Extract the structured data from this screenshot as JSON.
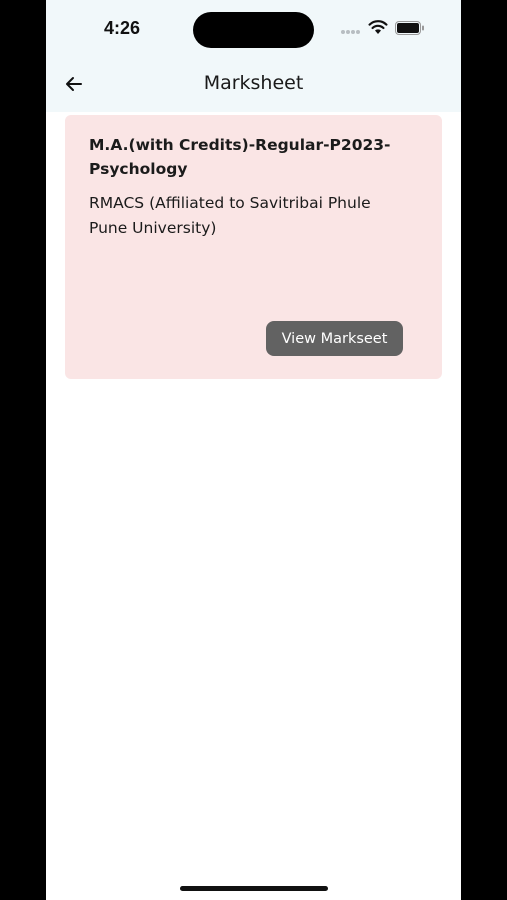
{
  "status_bar": {
    "time": "4:26",
    "icons": [
      "signal-dots-icon",
      "wifi-icon",
      "battery-icon"
    ]
  },
  "header": {
    "back_icon": "arrow-left-icon",
    "title": "Marksheet"
  },
  "marksheets": [
    {
      "course": "M.A.(with Credits)-Regular-P2023-Psychology",
      "college": "RMACS (Affiliated to Savitribai Phule Pune University)",
      "button_label": "View Markseet"
    }
  ],
  "colors": {
    "header_bg": "#f1f8fa",
    "card_bg": "#fae5e5",
    "button_bg": "#626262",
    "button_text": "#ffffff"
  }
}
